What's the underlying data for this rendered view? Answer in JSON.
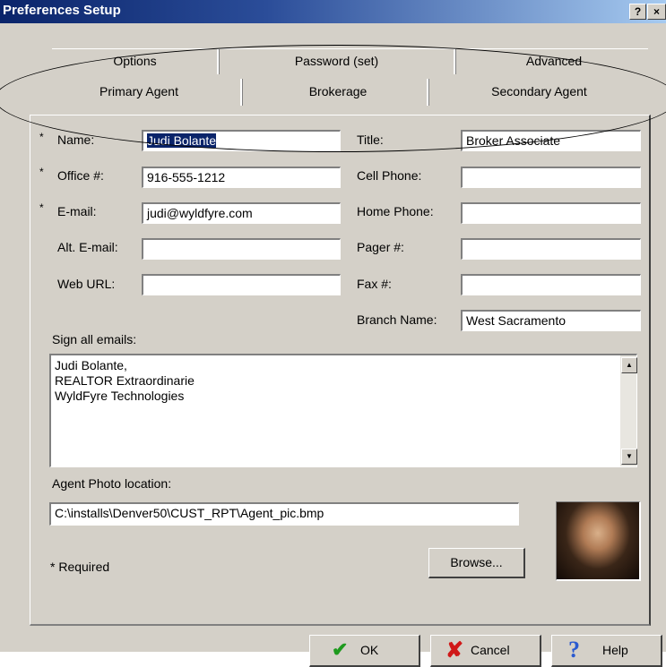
{
  "window": {
    "title": "Preferences Setup",
    "help_btn": "?",
    "close_btn": "×"
  },
  "tabs": {
    "row1": [
      "Options",
      "Password (set)",
      "Advanced"
    ],
    "row2": [
      "Primary Agent",
      "Brokerage",
      "Secondary Agent"
    ],
    "active": "Primary Agent"
  },
  "form": {
    "name_label": "Name:",
    "name_value": "Judi Bolante",
    "office_label": "Office #:",
    "office_value": "916-555-1212",
    "email_label": "E-mail:",
    "email_value": "judi@wyldfyre.com",
    "alt_email_label": "Alt. E-mail:",
    "alt_email_value": "",
    "web_url_label": "Web URL:",
    "web_url_value": "",
    "title_label": "Title:",
    "title_value": "Broker Associate",
    "cell_label": "Cell Phone:",
    "cell_value": "",
    "home_label": "Home Phone:",
    "home_value": "",
    "pager_label": "Pager #:",
    "pager_value": "",
    "fax_label": "Fax #:",
    "fax_value": "",
    "branch_label": "Branch Name:",
    "branch_value": "West Sacramento",
    "required_marker": "*"
  },
  "signature": {
    "label": "Sign all emails:",
    "lines": [
      "Judi Bolante,",
      "REALTOR Extraordinarie",
      "WyldFyre Technologies"
    ]
  },
  "photo": {
    "label": "Agent Photo location:",
    "path": "C:\\installs\\Denver50\\CUST_RPT\\Agent_pic.bmp",
    "browse_label": "Browse..."
  },
  "footer": {
    "required_note": "* Required",
    "ok_label": "OK",
    "cancel_label": "Cancel",
    "help_label": "Help"
  },
  "icons": {
    "ok": "check-icon",
    "cancel": "x-icon",
    "help": "question-icon"
  }
}
